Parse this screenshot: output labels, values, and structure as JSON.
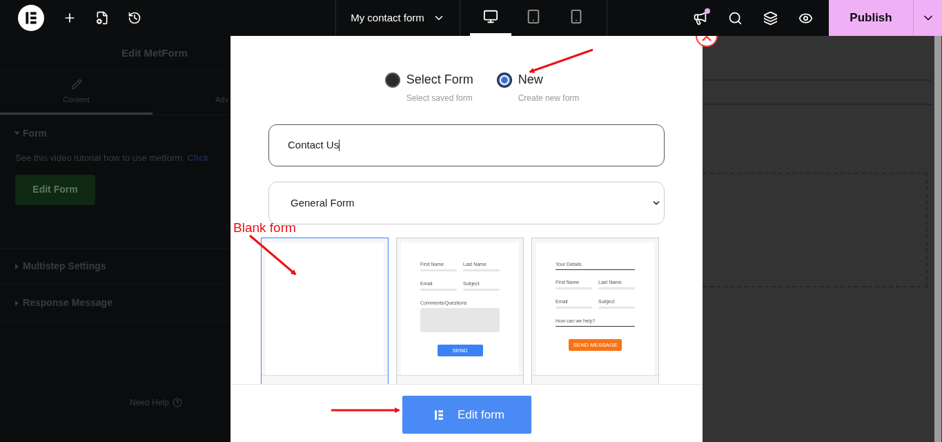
{
  "topbar": {
    "document_title": "My contact form",
    "devices": [
      {
        "kind": "desktop",
        "selected": true
      },
      {
        "kind": "tablet",
        "selected": false
      },
      {
        "kind": "mobile",
        "selected": false
      }
    ],
    "notification": true,
    "publish": "Publish"
  },
  "panel": {
    "title": "Edit MetForm",
    "tabs": [
      {
        "label": "Content",
        "selected": true
      },
      {
        "label": "Adv",
        "selected": false
      }
    ],
    "sections": [
      {
        "title": "Form",
        "expanded": true,
        "description": "See this video tutorial how to use metform.",
        "link": "Click",
        "button": "Edit Form"
      },
      {
        "title": "Multistep Settings",
        "expanded": false
      },
      {
        "title": "Response Message",
        "expanded": false
      }
    ],
    "help": "Need Help"
  },
  "modal": {
    "mode_options": [
      {
        "label": "Select Form",
        "hint": "Select saved form",
        "selected": false
      },
      {
        "label": "New",
        "hint": "Create new form",
        "selected": true
      }
    ],
    "name_input": {
      "value": "Contact Us"
    },
    "form_type": "General Form",
    "templates": [
      {
        "kind": "blank",
        "selected": true
      },
      {
        "kind": "form",
        "selected": false,
        "fields": [
          {
            "label": "First Name",
            "kind": "input"
          },
          {
            "label": "Last Name",
            "kind": "input"
          },
          {
            "label": "Email",
            "kind": "input"
          },
          {
            "label": "Subject",
            "kind": "input"
          },
          {
            "label": "Comments/Questions",
            "kind": "textarea"
          }
        ],
        "button": {
          "label": "SEND",
          "color": "#3b82f6"
        }
      },
      {
        "kind": "form",
        "selected": false,
        "fields": [
          {
            "label": "Your Details",
            "kind": "underline"
          },
          {
            "label": "First Name",
            "kind": "input"
          },
          {
            "label": "Last Name",
            "kind": "input"
          },
          {
            "label": "Email",
            "kind": "input"
          },
          {
            "label": "Subject",
            "kind": "input"
          },
          {
            "label": "How can we help?",
            "kind": "underline"
          }
        ],
        "button": {
          "label": "SEND MESSAGE",
          "color": "#f97316"
        }
      }
    ],
    "primary_button": "Edit form"
  },
  "annotations": {
    "label": "Blank form"
  }
}
